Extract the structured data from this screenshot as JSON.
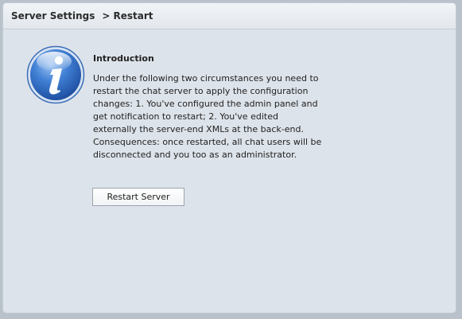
{
  "breadcrumb": {
    "section": "Server Settings",
    "separator": ">",
    "current": "Restart"
  },
  "intro": {
    "icon": "info-icon",
    "title": "Introduction",
    "text": "Under the following two circumstances you need to restart the chat server to apply the configuration changes:  1. You've configured the admin panel and get notification to restart;  2. You've edited externally the server-end XMLs at the back-end. Consequences: once restarted, all chat users will be disconnected and you too as an administrator."
  },
  "actions": {
    "restart_label": "Restart Server"
  }
}
